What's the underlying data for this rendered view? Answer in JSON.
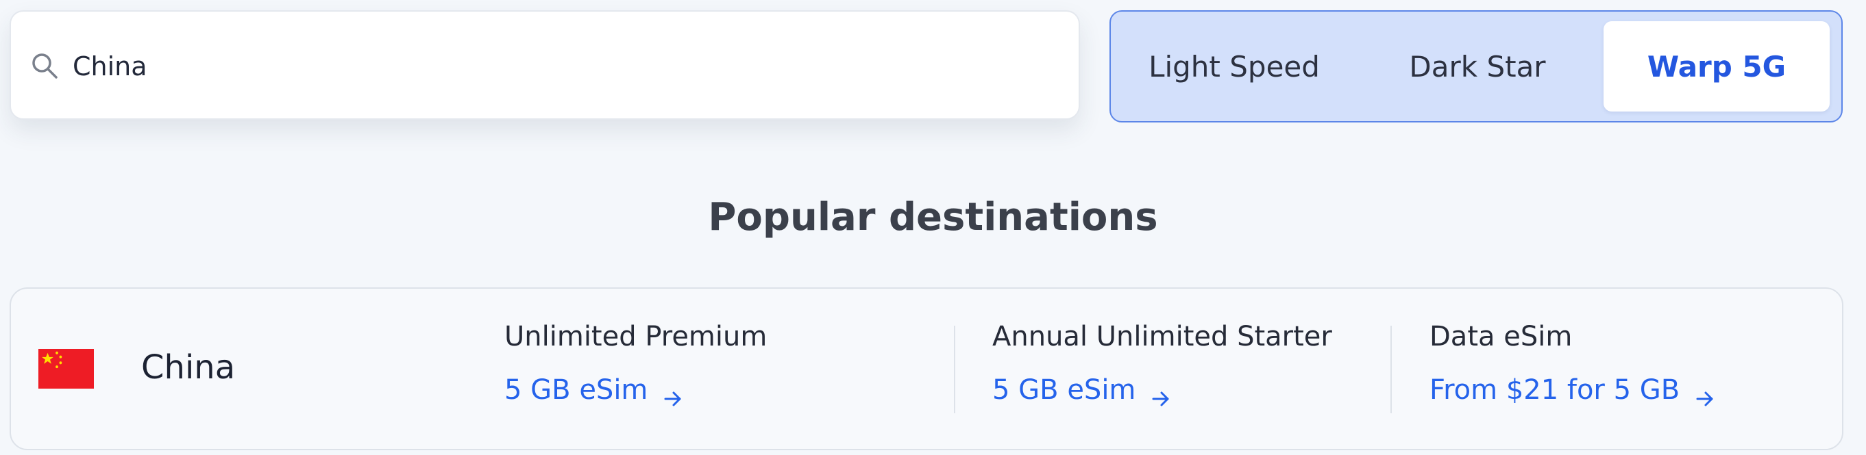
{
  "search": {
    "value": "China",
    "icon": "search-icon"
  },
  "network_switch": {
    "tabs": [
      {
        "label": "Light Speed",
        "selected": false
      },
      {
        "label": "Dark Star",
        "selected": false
      },
      {
        "label": "Warp 5G",
        "selected": true
      }
    ]
  },
  "section": {
    "title": "Popular destinations"
  },
  "destinations": [
    {
      "country": "China",
      "flag_icon": "china-flag-icon",
      "plans": [
        {
          "name": "Unlimited Premium",
          "link": "5 GB eSim"
        },
        {
          "name": "Annual Unlimited Starter",
          "link": "5 GB eSim"
        },
        {
          "name": "Data eSim",
          "link": "From $21 for 5 GB"
        }
      ]
    }
  ],
  "colors": {
    "accent": "#2563eb",
    "switch_background": "#d3e0fb",
    "switch_border": "#5c86e8",
    "page_background": "#f4f7fb",
    "flag_red": "#ee1c25",
    "flag_yellow": "#ffde00"
  }
}
